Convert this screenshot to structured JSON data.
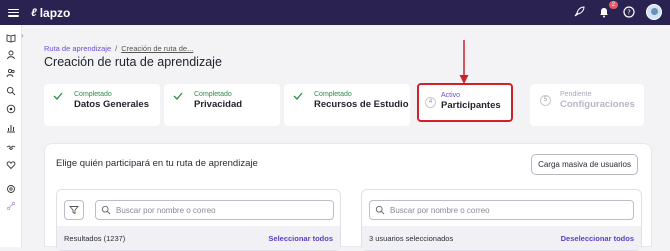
{
  "app": {
    "logo_text": "lapzo",
    "notifications_count": "2"
  },
  "breadcrumb": {
    "parent": "Ruta de aprendizaje",
    "separator": "/",
    "current": "Creación de ruta de..."
  },
  "page": {
    "title": "Creación de ruta de aprendizaje"
  },
  "steps": [
    {
      "status": "Completado",
      "name": "Datos Generales",
      "state": "done"
    },
    {
      "status": "Completado",
      "name": "Privacidad",
      "state": "done"
    },
    {
      "status": "Completado",
      "name": "Recursos de Estudio",
      "state": "done"
    },
    {
      "number": "4",
      "status": "Activo",
      "name": "Participantes",
      "state": "active"
    },
    {
      "number": "5",
      "status": "Pendiente",
      "name": "Configuraciones",
      "state": "pending"
    }
  ],
  "panel": {
    "title": "Elige quién participará en tu ruta de aprendizaje",
    "bulk_button": "Carga masiva de usuarios",
    "left": {
      "search_placeholder": "Buscar por nombre o correo",
      "results_label": "Resultados (1237)",
      "action": "Seleccionar todos"
    },
    "right": {
      "search_placeholder": "Buscar por nombre o correo",
      "selected_label": "3 usuarios seleccionados",
      "action": "Deseleccionar todos"
    }
  },
  "colors": {
    "topbar": "#2a2250",
    "accent": "#6a4fd0",
    "done": "#2f8a4a",
    "highlight": "#d0202a"
  }
}
